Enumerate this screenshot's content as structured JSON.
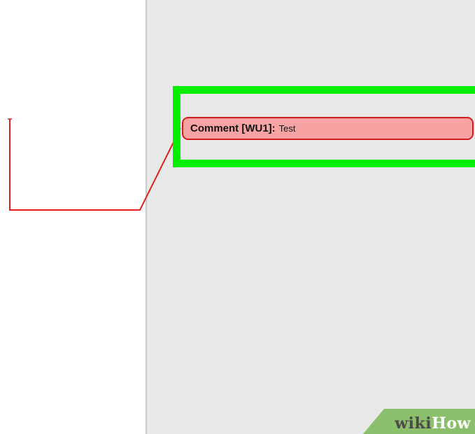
{
  "comment": {
    "label": "Comment [WU1]:",
    "text": "Test"
  },
  "watermark": {
    "wiki": "wiki",
    "how": "How"
  },
  "colors": {
    "highlight": "#00ee00",
    "balloon_fill": "#f7a3a3",
    "balloon_border": "#d41a1a",
    "connector": "#e02020",
    "markup_pane": "#e8e8e8",
    "watermark_green": "#8cbf6b"
  }
}
